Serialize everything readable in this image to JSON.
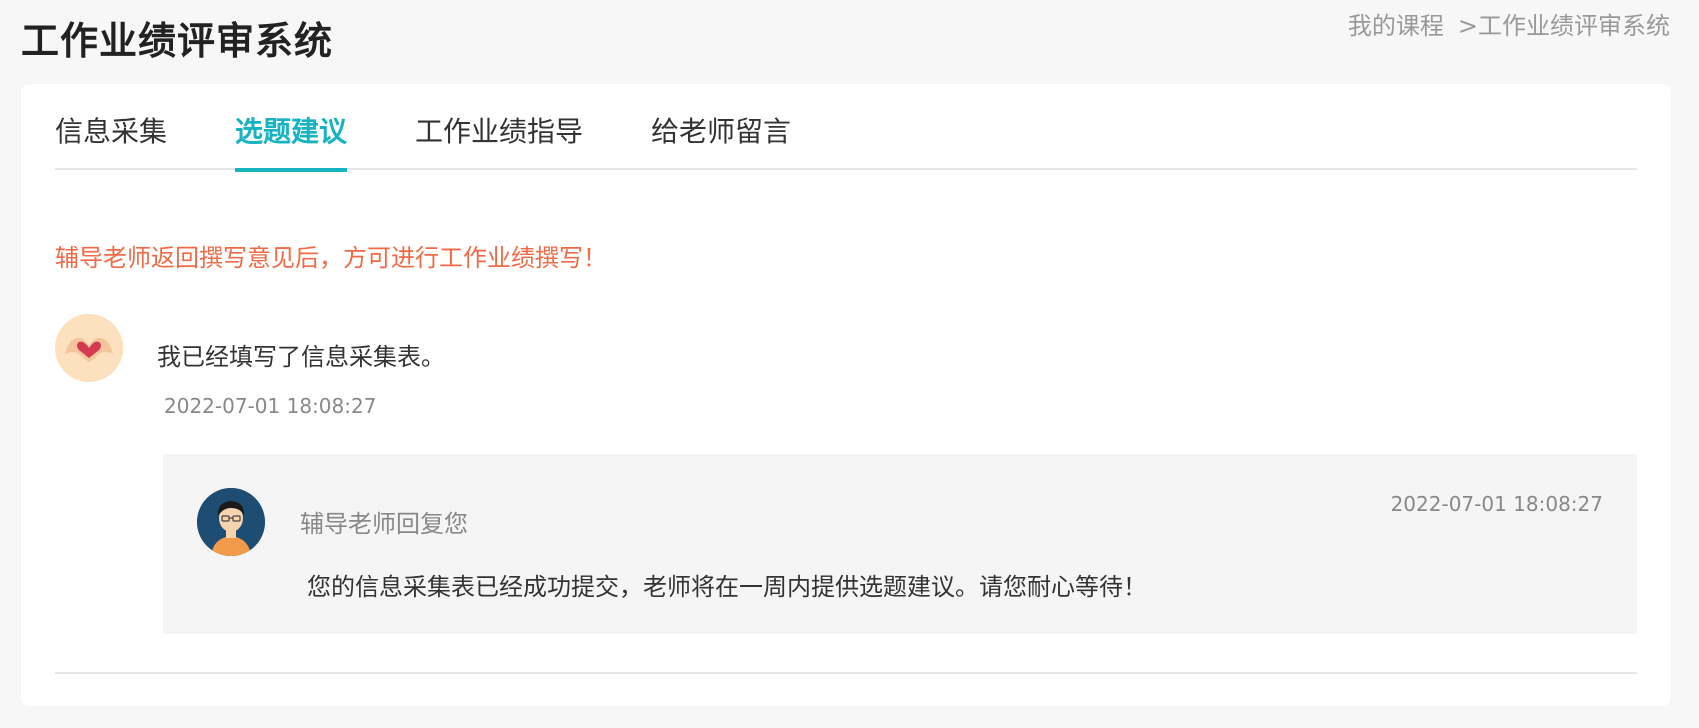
{
  "header": {
    "title": "工作业绩评审系统",
    "breadcrumb": {
      "parent": "我的课程",
      "separator": ">",
      "current": "工作业绩评审系统"
    }
  },
  "tabs": [
    {
      "label": "信息采集",
      "active": false
    },
    {
      "label": "选题建议",
      "active": true
    },
    {
      "label": "工作业绩指导",
      "active": false
    },
    {
      "label": "给老师留言",
      "active": false
    }
  ],
  "notice": "辅导老师返回撰写意见后，方可进行工作业绩撰写！",
  "message": {
    "avatar_icon": "heart-hands-avatar",
    "text": "我已经填写了信息采集表。",
    "time": "2022-07-01 18:08:27"
  },
  "reply": {
    "avatar_icon": "teacher-avatar",
    "author": "辅导老师回复您",
    "time": "2022-07-01 18:08:27",
    "text": "您的信息采集表已经成功提交，老师将在一周内提供选题建议。请您耐心等待！"
  },
  "colors": {
    "accent": "#17b3c2",
    "notice": "#ef6a45"
  }
}
